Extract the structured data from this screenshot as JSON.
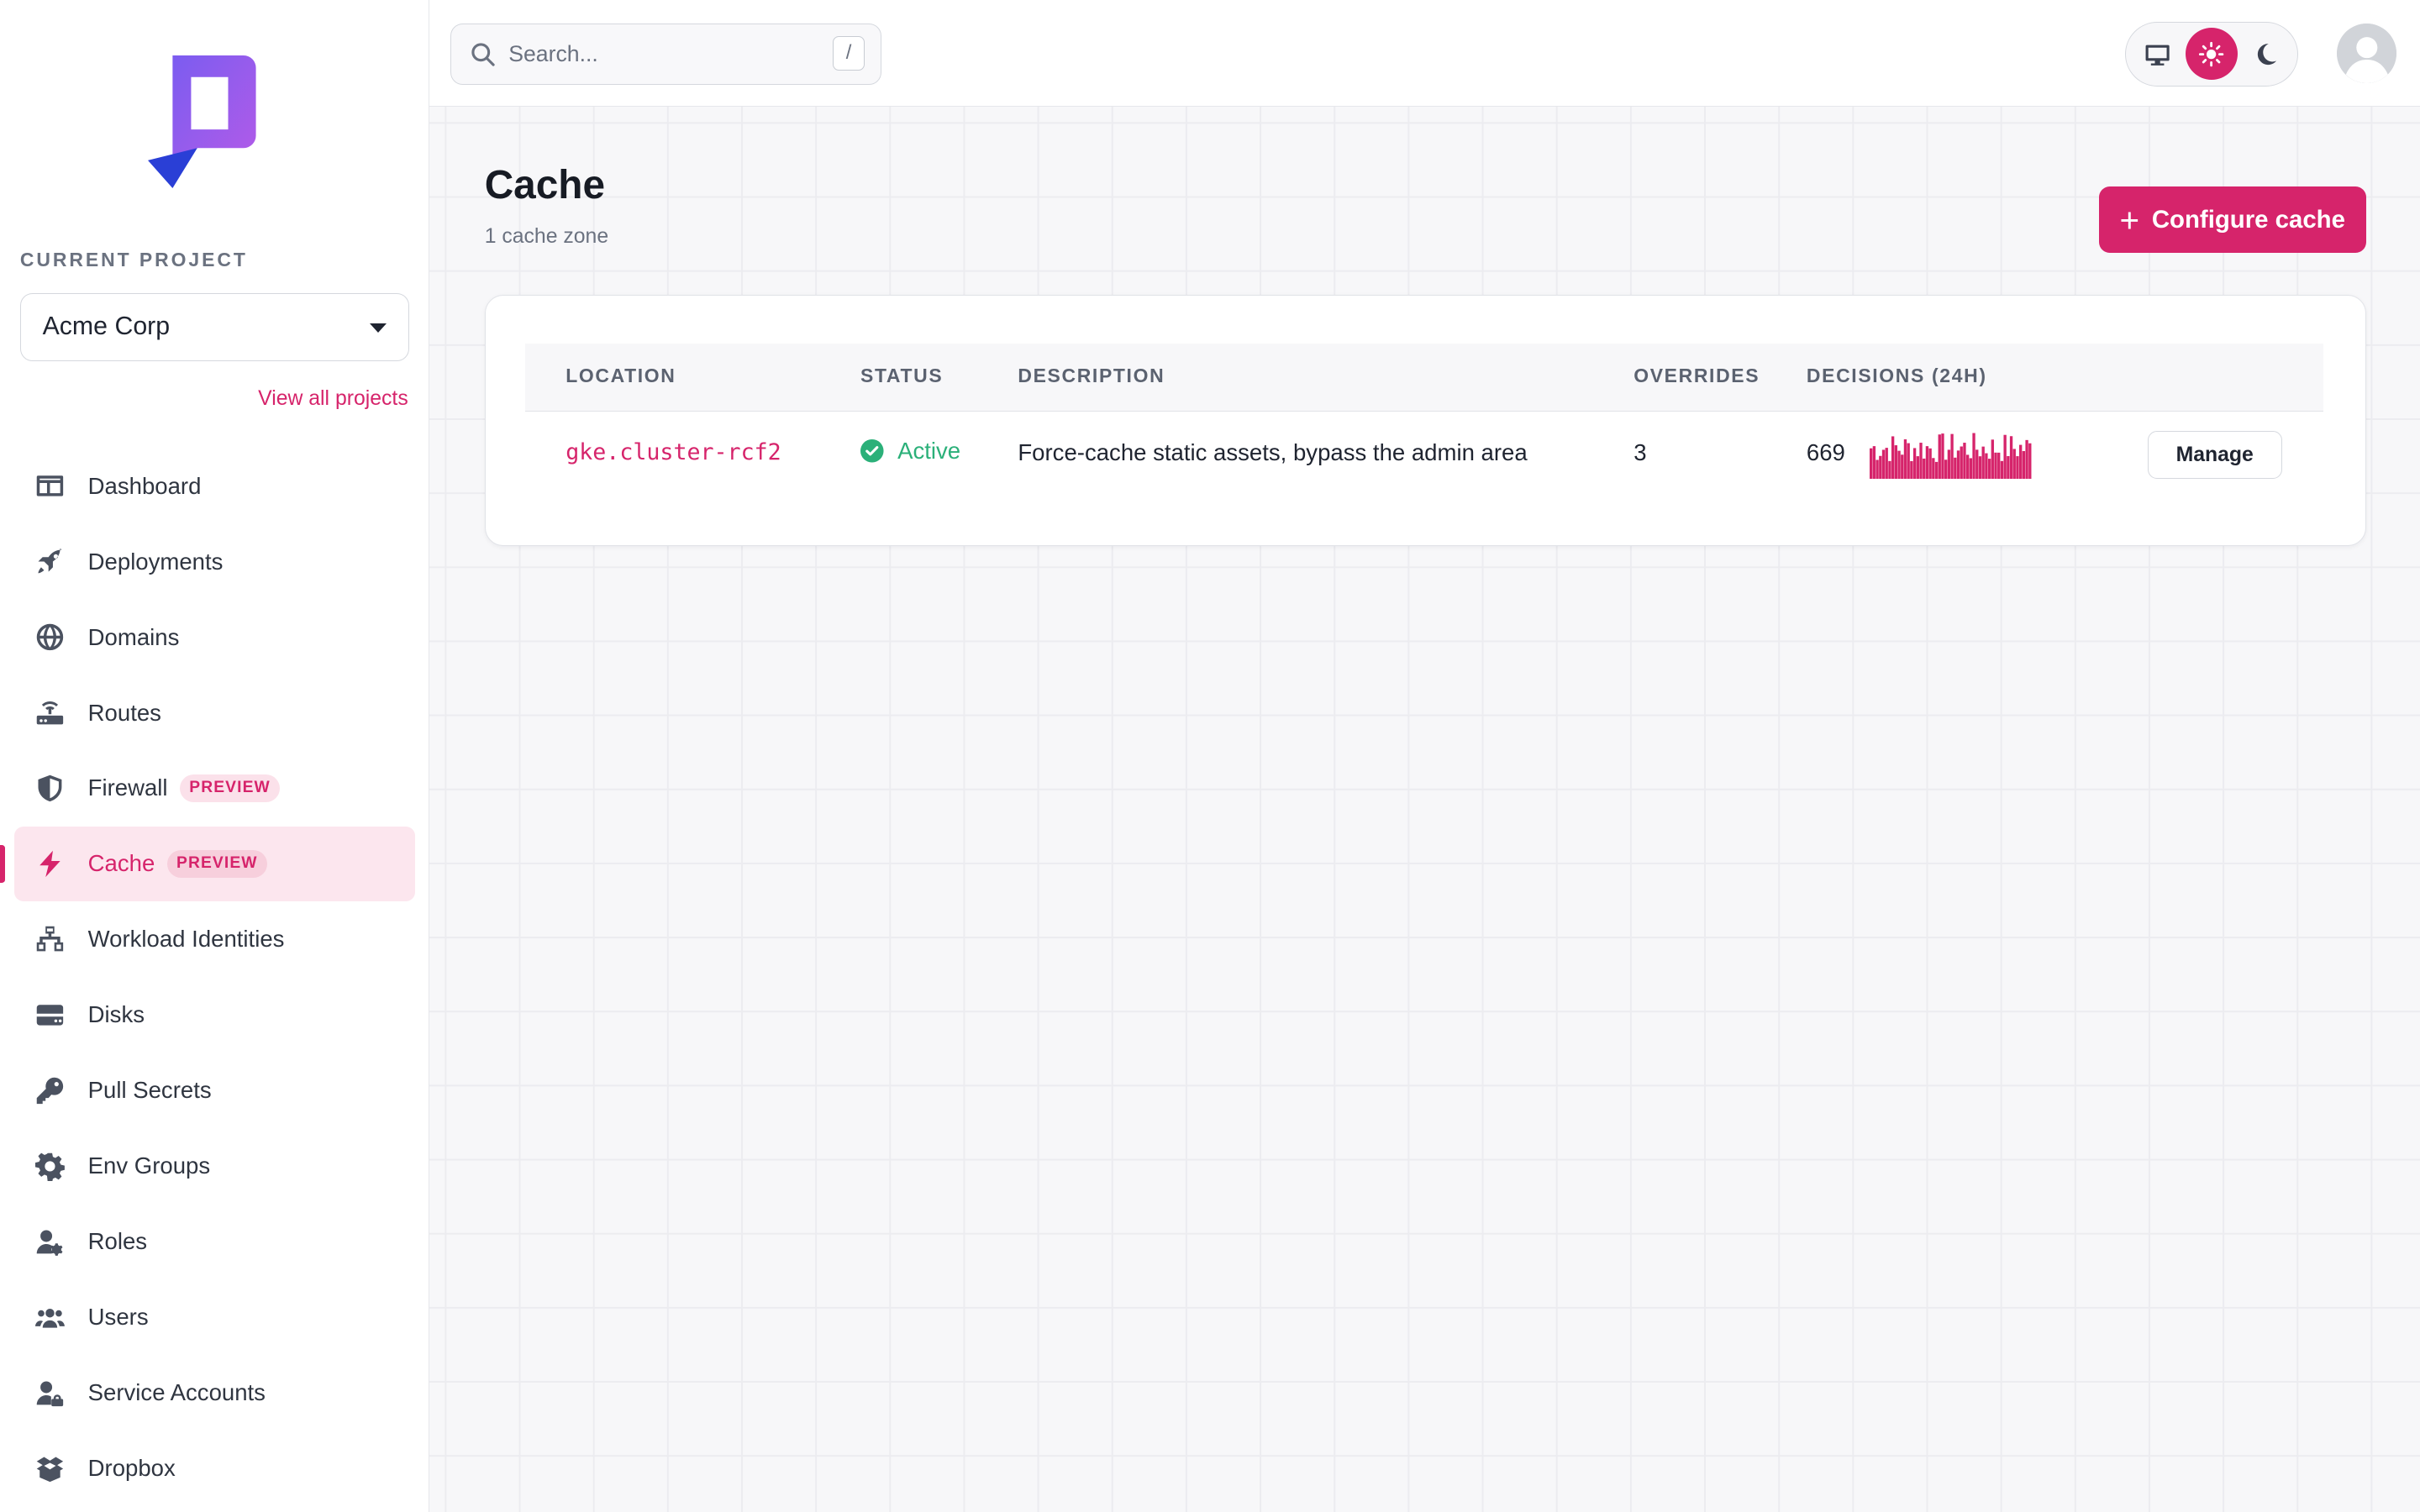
{
  "sidebar": {
    "current_project_label": "CURRENT PROJECT",
    "project_name": "Acme Corp",
    "view_all": "View all projects",
    "items": [
      {
        "label": "Dashboard",
        "icon": "dashboard-icon"
      },
      {
        "label": "Deployments",
        "icon": "rocket-icon"
      },
      {
        "label": "Domains",
        "icon": "globe-icon"
      },
      {
        "label": "Routes",
        "icon": "router-icon"
      },
      {
        "label": "Firewall",
        "icon": "shield-icon",
        "badge": "PREVIEW"
      },
      {
        "label": "Cache",
        "icon": "bolt-icon",
        "badge": "PREVIEW",
        "active": true
      },
      {
        "label": "Workload Identities",
        "icon": "sitemap-icon"
      },
      {
        "label": "Disks",
        "icon": "hard-drive-icon"
      },
      {
        "label": "Pull Secrets",
        "icon": "key-icon"
      },
      {
        "label": "Env Groups",
        "icon": "gear-icon"
      },
      {
        "label": "Roles",
        "icon": "user-gear-icon"
      },
      {
        "label": "Users",
        "icon": "users-icon"
      },
      {
        "label": "Service Accounts",
        "icon": "user-lock-icon"
      },
      {
        "label": "Dropbox",
        "icon": "box-open-icon"
      }
    ]
  },
  "header": {
    "search_placeholder": "Search...",
    "search_shortcut": "/",
    "theme_options": [
      "system",
      "light",
      "dark"
    ],
    "theme_selected": "light"
  },
  "page": {
    "title": "Cache",
    "subtitle": "1 cache zone",
    "primary_button": "Configure cache"
  },
  "table": {
    "columns": [
      "LOCATION",
      "STATUS",
      "DESCRIPTION",
      "OVERRIDES",
      "DECISIONS (24H)"
    ],
    "rows": [
      {
        "location": "gke.cluster-rcf2",
        "status": "Active",
        "description": "Force-cache static assets, bypass the admin area",
        "overrides": "3",
        "decisions": "669",
        "action": "Manage"
      }
    ]
  },
  "colors": {
    "accent": "#d6246b",
    "accent_soft": "#fce6ee",
    "success": "#2bb079",
    "text": "#1f2430",
    "muted": "#6b7280"
  }
}
